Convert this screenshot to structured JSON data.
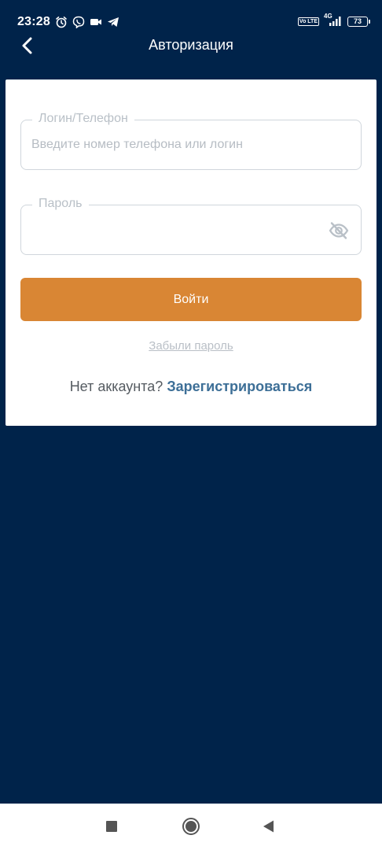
{
  "status_bar": {
    "time": "23:28",
    "left_icons": [
      "alarm-icon",
      "viber-icon",
      "video-camera-icon",
      "telegram-icon"
    ],
    "right_icons": [
      "volte-icon",
      "signal-4g-icon",
      "battery-icon"
    ],
    "network": "4G",
    "volte": "Vo LTE",
    "battery_level": "73"
  },
  "header": {
    "title": "Авторизация",
    "back_icon": "chevron-left-icon"
  },
  "form": {
    "login": {
      "label": "Логин/Телефон",
      "placeholder": "Введите номер телефона или логин",
      "value": ""
    },
    "password": {
      "label": "Пароль",
      "value": "",
      "toggle_icon": "eye-off-icon"
    },
    "submit_label": "Войти",
    "forgot_label": "Забыли пароль",
    "no_account_text": "Нет аккаунта?",
    "register_label": "Зарегистрироваться"
  },
  "nav_bar": {
    "buttons": [
      "recent-apps-icon",
      "home-icon",
      "back-triangle-icon"
    ]
  },
  "colors": {
    "background": "#00234a",
    "card": "#ffffff",
    "accent_button": "#d98634",
    "register_link": "#3d6f97",
    "field_border": "#d0d6dc"
  }
}
